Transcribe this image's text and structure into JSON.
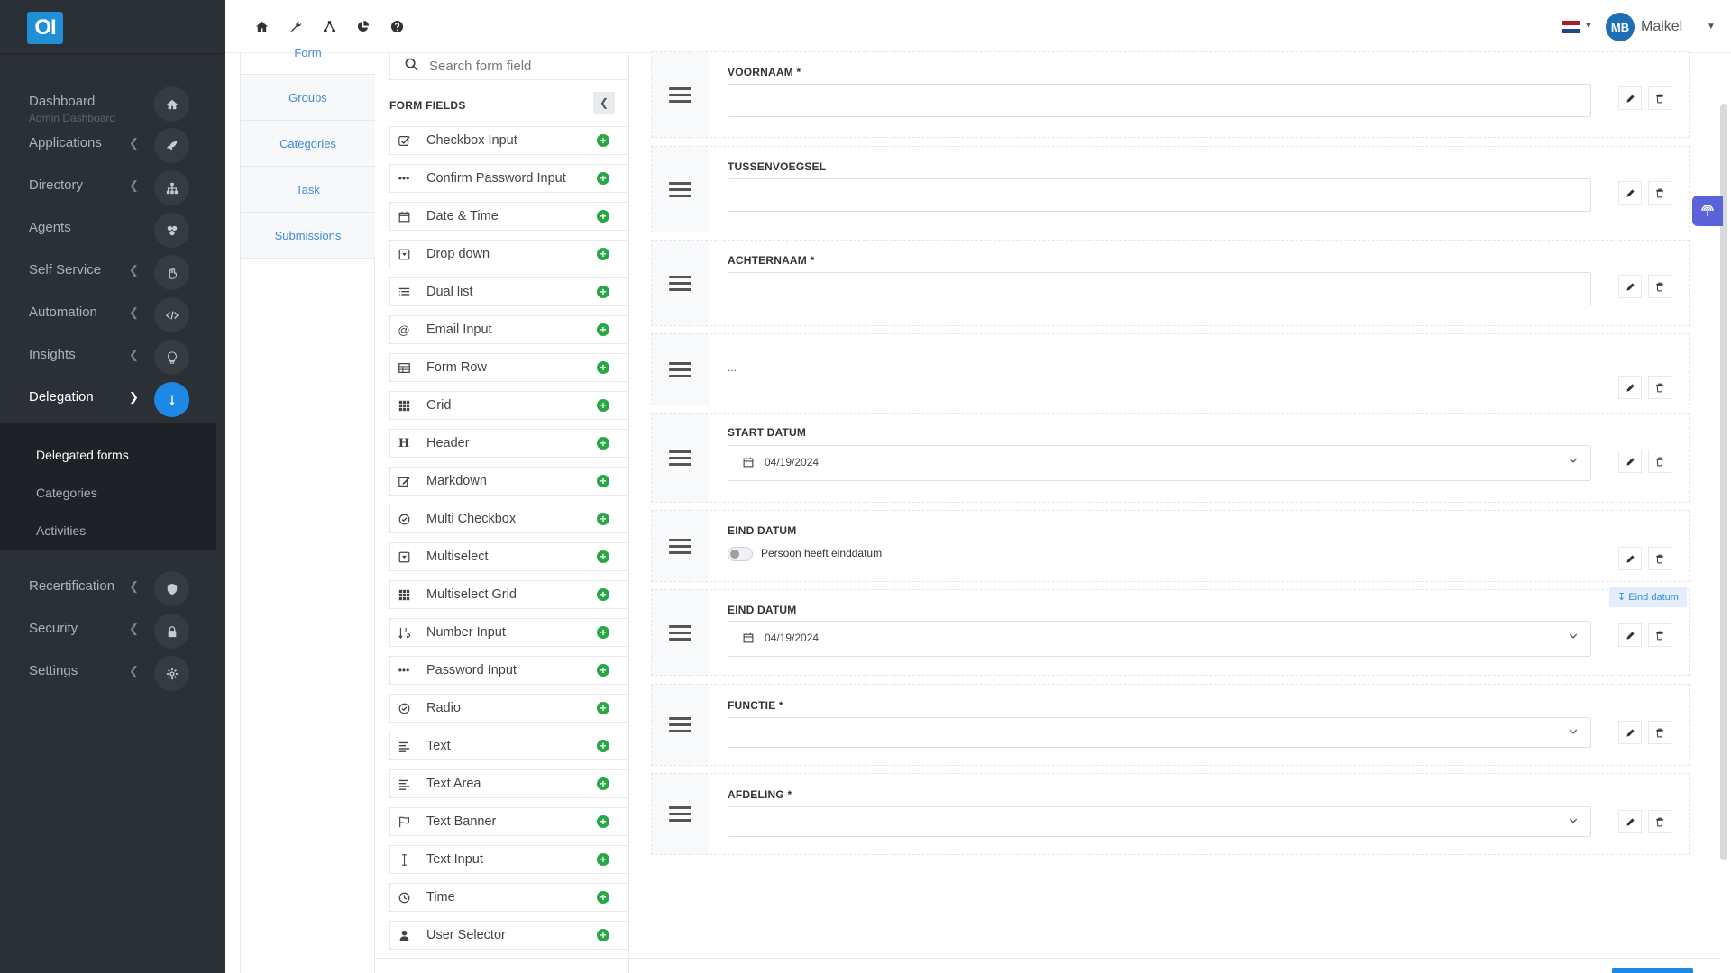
{
  "app": {
    "logo_text": "OI"
  },
  "sidebar": {
    "items": [
      {
        "label": "Dashboard",
        "sub": "Admin Dashboard",
        "icon": "home-icon"
      },
      {
        "label": "Applications",
        "icon": "rocket-icon"
      },
      {
        "label": "Directory",
        "icon": "sitemap-icon"
      },
      {
        "label": "Agents",
        "icon": "agents-icon"
      },
      {
        "label": "Self Service",
        "icon": "hand-icon"
      },
      {
        "label": "Automation",
        "icon": "code-icon"
      },
      {
        "label": "Insights",
        "icon": "lightbulb-icon"
      },
      {
        "label": "Delegation",
        "icon": "delegation-icon"
      },
      {
        "label": "Recertification",
        "icon": "shield-icon"
      },
      {
        "label": "Security",
        "icon": "lock-icon"
      },
      {
        "label": "Settings",
        "icon": "gear-icon"
      }
    ],
    "subitems": [
      {
        "label": "Delegated forms"
      },
      {
        "label": "Categories"
      },
      {
        "label": "Activities"
      }
    ]
  },
  "topbar": {
    "icons": [
      "home-icon",
      "wrench-icon",
      "network-icon",
      "pie-chart-icon",
      "help-icon"
    ],
    "user": {
      "initials": "MB",
      "name": "Maikel"
    },
    "flag_colors": [
      "#ae1c28",
      "#ffffff",
      "#21468b"
    ]
  },
  "tabs": [
    {
      "label": "Form"
    },
    {
      "label": "Groups"
    },
    {
      "label": "Categories"
    },
    {
      "label": "Task"
    },
    {
      "label": "Submissions"
    }
  ],
  "fields_panel": {
    "search_placeholder": "Search form field",
    "title": "FORM FIELDS",
    "items": [
      {
        "label": "Checkbox Input",
        "icon": "checkbox-icon"
      },
      {
        "label": "Confirm Password Input",
        "icon": "password-dots-icon"
      },
      {
        "label": "Date & Time",
        "icon": "calendar-icon"
      },
      {
        "label": "Drop down",
        "icon": "dropdown-icon"
      },
      {
        "label": "Dual list",
        "icon": "list-icon"
      },
      {
        "label": "Email Input",
        "icon": "at-icon"
      },
      {
        "label": "Form Row",
        "icon": "table-icon"
      },
      {
        "label": "Grid",
        "icon": "grid-icon"
      },
      {
        "label": "Header",
        "icon": "heading-icon"
      },
      {
        "label": "Markdown",
        "icon": "edit-icon"
      },
      {
        "label": "Multi Checkbox",
        "icon": "check-circle-icon"
      },
      {
        "label": "Multiselect",
        "icon": "dropdown-icon"
      },
      {
        "label": "Multiselect Grid",
        "icon": "grid-icon"
      },
      {
        "label": "Number Input",
        "icon": "sort-numeric-icon"
      },
      {
        "label": "Password Input",
        "icon": "password-dots-icon"
      },
      {
        "label": "Radio",
        "icon": "radio-icon"
      },
      {
        "label": "Text",
        "icon": "align-left-icon"
      },
      {
        "label": "Text Area",
        "icon": "align-left-icon"
      },
      {
        "label": "Text Banner",
        "icon": "flag-icon"
      },
      {
        "label": "Text Input",
        "icon": "text-cursor-icon"
      },
      {
        "label": "Time",
        "icon": "clock-icon"
      },
      {
        "label": "User Selector",
        "icon": "user-icon"
      }
    ]
  },
  "canvas": {
    "rows": [
      {
        "label": "VOORNAAM *",
        "type": "text"
      },
      {
        "label": "TUSSENVOEGSEL",
        "type": "text"
      },
      {
        "label": "ACHTERNAAM *",
        "type": "text"
      },
      {
        "label": "",
        "type": "ellipsis",
        "text": "..."
      },
      {
        "label": "START DATUM",
        "type": "date",
        "value": "04/19/2024"
      },
      {
        "label": "EIND DATUM",
        "type": "toggle",
        "toggle_label": "Persoon heeft einddatum"
      },
      {
        "label": "EIND DATUM",
        "type": "date",
        "value": "04/19/2024"
      },
      {
        "label": "FUNCTIE *",
        "type": "select"
      },
      {
        "label": "AFDELING *",
        "type": "select"
      }
    ],
    "condition_badge": "Eind datum"
  }
}
